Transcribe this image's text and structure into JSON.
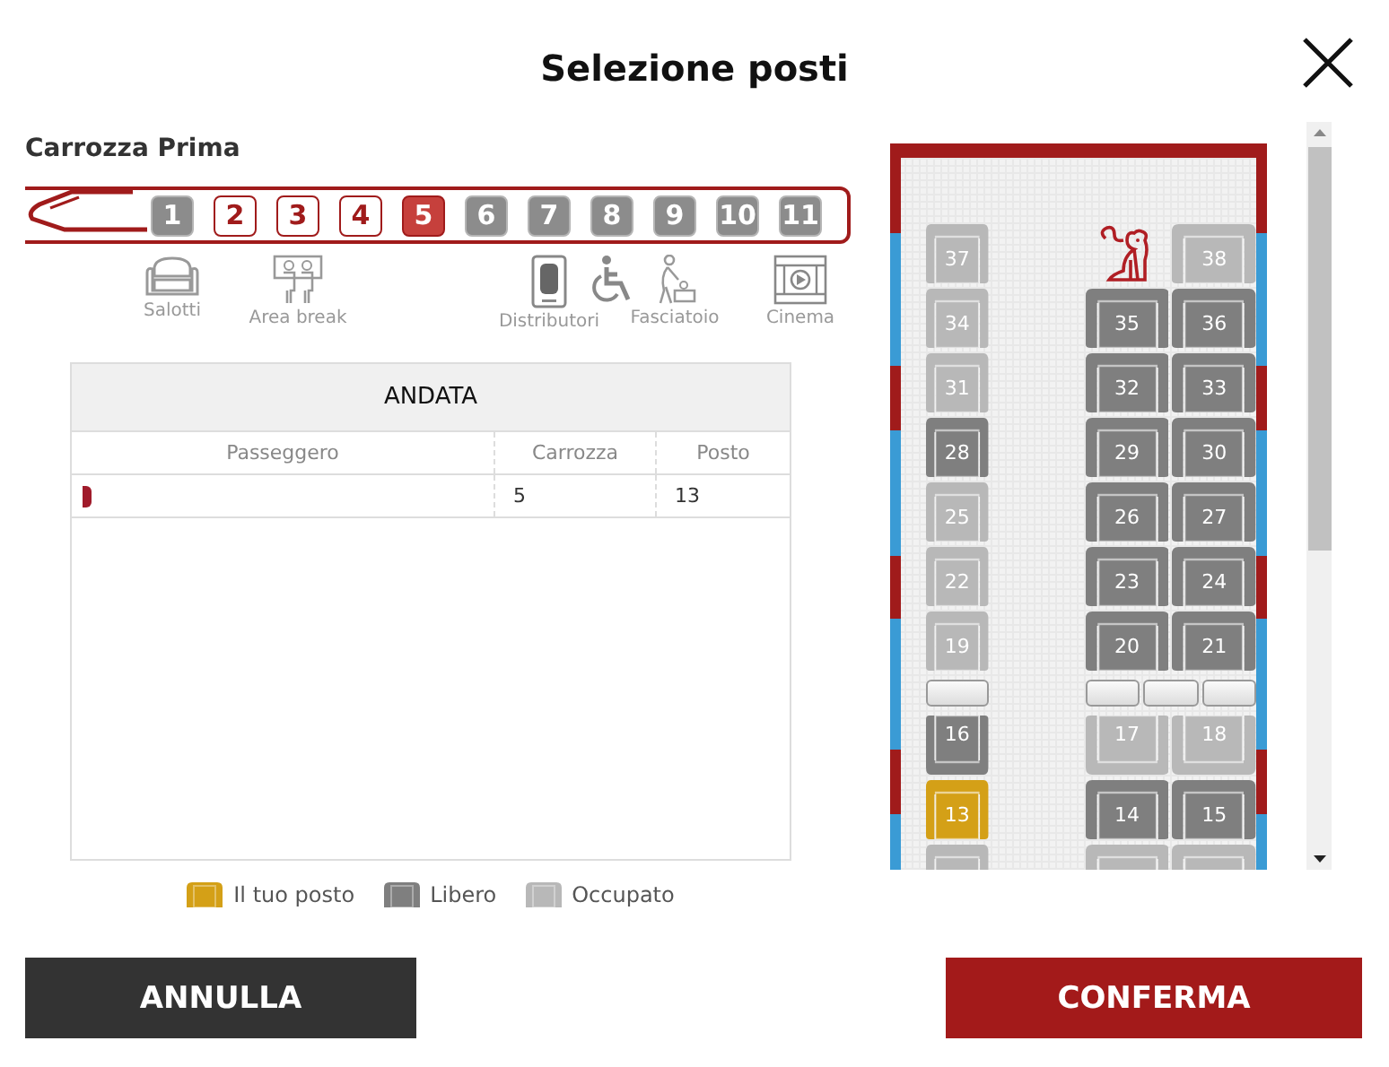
{
  "title": "Selezione posti",
  "coach_class": "Carrozza Prima",
  "coaches": [
    {
      "label": "1",
      "available": false,
      "selected": false,
      "amenities": [
        {
          "kind": "armchair",
          "label": "Salotti"
        }
      ]
    },
    {
      "label": "2",
      "available": true,
      "selected": false
    },
    {
      "label": "3",
      "available": true,
      "selected": false,
      "amenities": [
        {
          "kind": "people",
          "label": "Area break"
        }
      ]
    },
    {
      "label": "4",
      "available": true,
      "selected": false
    },
    {
      "label": "5",
      "available": true,
      "selected": true
    },
    {
      "label": "6",
      "available": false,
      "selected": false
    },
    {
      "label": "7",
      "available": false,
      "selected": false,
      "amenities": [
        {
          "kind": "vending",
          "label": "Distributori"
        }
      ]
    },
    {
      "label": "8",
      "available": false,
      "selected": false,
      "amenities": [
        {
          "kind": "wheelchair"
        }
      ]
    },
    {
      "label": "9",
      "available": false,
      "selected": false,
      "amenities": [
        {
          "kind": "baby",
          "label": "Fasciatoio"
        }
      ]
    },
    {
      "label": "10",
      "available": false,
      "selected": false
    },
    {
      "label": "11",
      "available": false,
      "selected": false,
      "amenities": [
        {
          "kind": "film",
          "label": "Cinema"
        }
      ]
    }
  ],
  "journey": {
    "heading": "ANDATA",
    "columns": [
      "Passeggero",
      "Carrozza",
      "Posto"
    ],
    "rows": [
      {
        "coach": "5",
        "seat": "13"
      }
    ]
  },
  "legend": [
    {
      "color": "#d4a017",
      "label": "Il tuo posto"
    },
    {
      "color": "#7f7f7f",
      "label": "Libero"
    },
    {
      "color": "#b8b8b8",
      "label": "Occupato"
    }
  ],
  "seat_map": {
    "rows": [
      {
        "left": [
          {
            "kind": "seat",
            "number": "37",
            "occupied": true,
            "selected": false,
            "reversed": false
          }
        ],
        "right": [
          {
            "kind": "pet"
          },
          {
            "kind": "seat",
            "number": "38",
            "occupied": true,
            "selected": false,
            "reversed": false
          }
        ]
      },
      {
        "left": [
          {
            "kind": "seat",
            "number": "34",
            "occupied": true,
            "selected": false,
            "reversed": false
          }
        ],
        "right": [
          {
            "kind": "seat",
            "number": "35",
            "occupied": false,
            "selected": false,
            "reversed": false
          },
          {
            "kind": "seat",
            "number": "36",
            "occupied": false,
            "selected": false,
            "reversed": false
          }
        ]
      },
      {
        "left": [
          {
            "kind": "seat",
            "number": "31",
            "occupied": true,
            "selected": false,
            "reversed": false
          }
        ],
        "right": [
          {
            "kind": "seat",
            "number": "32",
            "occupied": false,
            "selected": false,
            "reversed": false
          },
          {
            "kind": "seat",
            "number": "33",
            "occupied": false,
            "selected": false,
            "reversed": false
          }
        ]
      },
      {
        "left": [
          {
            "kind": "seat",
            "number": "28",
            "occupied": false,
            "selected": false,
            "reversed": false
          }
        ],
        "right": [
          {
            "kind": "seat",
            "number": "29",
            "occupied": false,
            "selected": false,
            "reversed": false
          },
          {
            "kind": "seat",
            "number": "30",
            "occupied": false,
            "selected": false,
            "reversed": false
          }
        ]
      },
      {
        "left": [
          {
            "kind": "seat",
            "number": "25",
            "occupied": true,
            "selected": false,
            "reversed": false
          }
        ],
        "right": [
          {
            "kind": "seat",
            "number": "26",
            "occupied": false,
            "selected": false,
            "reversed": false
          },
          {
            "kind": "seat",
            "number": "27",
            "occupied": false,
            "selected": false,
            "reversed": false
          }
        ]
      },
      {
        "left": [
          {
            "kind": "seat",
            "number": "22",
            "occupied": true,
            "selected": false,
            "reversed": false
          }
        ],
        "right": [
          {
            "kind": "seat",
            "number": "23",
            "occupied": false,
            "selected": false,
            "reversed": false
          },
          {
            "kind": "seat",
            "number": "24",
            "occupied": false,
            "selected": false,
            "reversed": false
          }
        ]
      },
      {
        "left": [
          {
            "kind": "seat",
            "number": "19",
            "occupied": true,
            "selected": false,
            "reversed": false
          }
        ],
        "right": [
          {
            "kind": "seat",
            "number": "20",
            "occupied": false,
            "selected": false,
            "reversed": false
          },
          {
            "kind": "seat",
            "number": "21",
            "occupied": false,
            "selected": false,
            "reversed": false
          }
        ]
      },
      {
        "left": [
          {
            "kind": "table"
          }
        ],
        "right": [
          {
            "kind": "table"
          },
          {
            "kind": "table"
          },
          {
            "kind": "table"
          }
        ]
      },
      {
        "left": [
          {
            "kind": "seat",
            "number": "16",
            "occupied": false,
            "selected": false,
            "reversed": true
          }
        ],
        "right": [
          {
            "kind": "seat",
            "number": "17",
            "occupied": true,
            "selected": false,
            "reversed": true
          },
          {
            "kind": "seat",
            "number": "18",
            "occupied": true,
            "selected": false,
            "reversed": true
          }
        ]
      },
      {
        "left": [
          {
            "kind": "seat",
            "number": "13",
            "selected": true,
            "reversed": false
          }
        ],
        "right": [
          {
            "kind": "seat",
            "number": "14",
            "occupied": false,
            "selected": false,
            "reversed": false
          },
          {
            "kind": "seat",
            "number": "15",
            "occupied": false,
            "selected": false,
            "reversed": false
          }
        ]
      },
      {
        "left": [
          {
            "kind": "seat",
            "occupied": true,
            "selected": false,
            "reversed": false
          }
        ],
        "right": [
          {
            "kind": "seat",
            "occupied": true,
            "selected": false,
            "reversed": false
          },
          {
            "kind": "seat",
            "occupied": true,
            "selected": false,
            "reversed": false
          }
        ]
      }
    ]
  },
  "buttons": {
    "cancel": "ANNULLA",
    "confirm": "CONFERMA"
  }
}
